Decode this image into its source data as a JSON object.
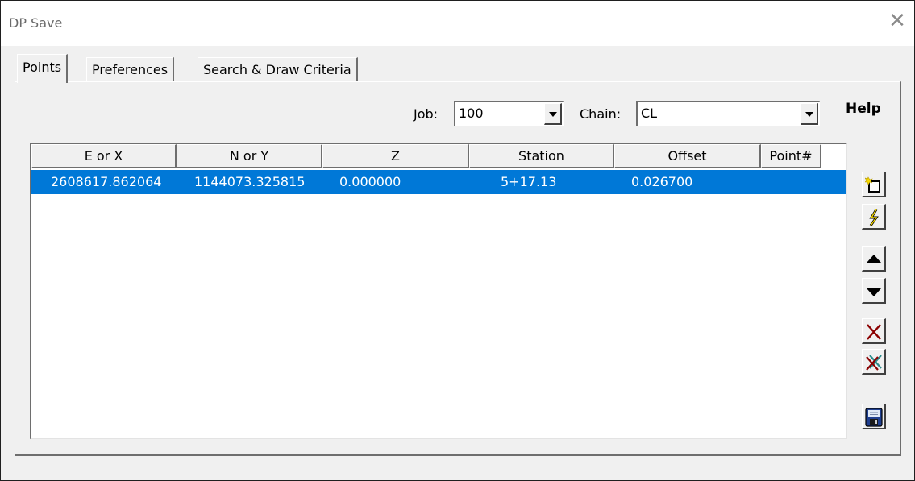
{
  "window": {
    "title": "DP Save",
    "close_glyph": "✕"
  },
  "tabs": [
    {
      "label": "Points",
      "active": true
    },
    {
      "label": "Preferences",
      "active": false
    },
    {
      "label": "Search & Draw Criteria",
      "active": false
    }
  ],
  "filters": {
    "job_label": "Job:",
    "job_value": "100",
    "chain_label": "Chain:",
    "chain_value": "CL"
  },
  "help_link": "Help",
  "table": {
    "columns": [
      "E or X",
      "N or Y",
      "Z",
      "Station",
      "Offset",
      "Point#"
    ],
    "rows": [
      {
        "e": "2608617.862064",
        "n": "1144073.325815",
        "z": "0.000000",
        "station": "5+17.13",
        "offset": "0.026700",
        "point": "",
        "selected": true
      }
    ]
  },
  "toolbar": [
    {
      "icon": "new-point-icon"
    },
    {
      "icon": "edit-point-icon"
    },
    {
      "icon": "move-up-icon"
    },
    {
      "icon": "move-down-icon"
    },
    {
      "icon": "delete-icon"
    },
    {
      "icon": "delete-all-icon"
    },
    {
      "icon": "save-icon"
    }
  ],
  "colors": {
    "selection": "#0078d7",
    "delete": "#8b0000"
  }
}
